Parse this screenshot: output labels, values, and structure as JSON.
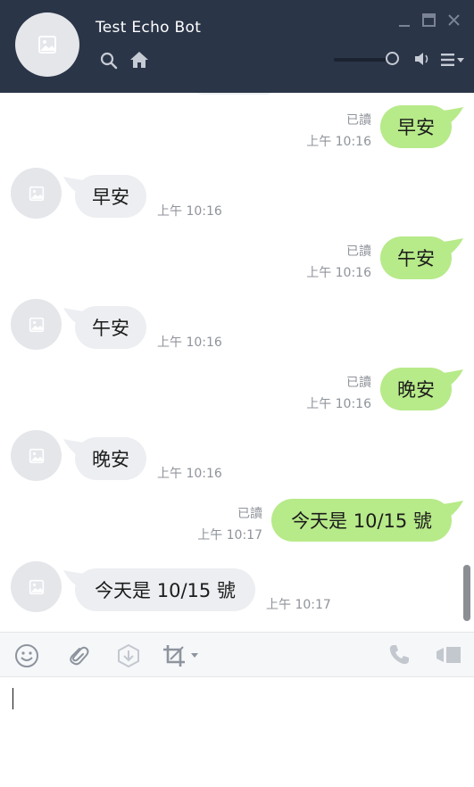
{
  "header": {
    "title": "Test Echo Bot",
    "icons": [
      "image-placeholder-icon",
      "search-icon",
      "home-icon",
      "minimize-icon",
      "maximize-icon",
      "close-icon",
      "volume-icon",
      "menu-icon"
    ],
    "volume_level": 0.85,
    "bg_color": "#2b3548"
  },
  "messages": [
    {
      "side": "sent",
      "text": "早安",
      "read": "已讀",
      "time": "上午 10:16"
    },
    {
      "side": "recv",
      "text": "早安",
      "time": "上午 10:16"
    },
    {
      "side": "sent",
      "text": "午安",
      "read": "已讀",
      "time": "上午 10:16"
    },
    {
      "side": "recv",
      "text": "午安",
      "time": "上午 10:16"
    },
    {
      "side": "sent",
      "text": "晚安",
      "read": "已讀",
      "time": "上午 10:16"
    },
    {
      "side": "recv",
      "text": "晚安",
      "time": "上午 10:16"
    },
    {
      "side": "sent",
      "text": "今天是 10/15 號",
      "read": "已讀",
      "time": "上午 10:17"
    },
    {
      "side": "recv",
      "text": "今天是 10/15 號",
      "time": "上午 10:17"
    }
  ],
  "colors": {
    "sent_bubble": "#b7ea89",
    "recv_bubble": "#eceef1",
    "meta_text": "#8f939a"
  },
  "toolbar": {
    "icons": [
      "emoji-icon",
      "attachment-icon",
      "keep-icon",
      "crop-icon",
      "crop-dropdown-icon",
      "phone-icon",
      "video-call-icon"
    ]
  },
  "input": {
    "value": "",
    "placeholder": ""
  }
}
